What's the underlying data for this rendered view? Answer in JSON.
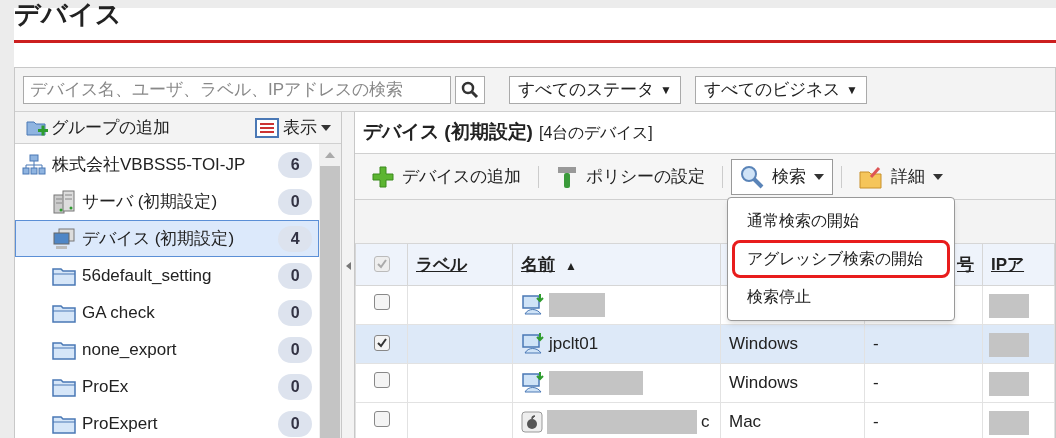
{
  "page_title": "デバイス",
  "filters": {
    "search_placeholder": "デバイス名、ユーザ、ラベル、IPアドレスの検索",
    "dropdowns": [
      {
        "label": "すべてのステータ",
        "caret": "▼"
      },
      {
        "label": "すべてのビジネス",
        "caret": "▼"
      }
    ]
  },
  "sidebar": {
    "add_group": "グループの追加",
    "view": "表示",
    "tree": [
      {
        "kind": "network",
        "label": "株式会社VBBSS5-TOI-JP",
        "count": "6",
        "selected": false,
        "children": [
          {
            "kind": "server",
            "label": "サーバ (初期設定)",
            "count": "0",
            "selected": false
          },
          {
            "kind": "device",
            "label": "デバイス (初期設定)",
            "count": "4",
            "selected": true
          },
          {
            "kind": "folder",
            "label": "56default_setting",
            "count": "0",
            "selected": false
          },
          {
            "kind": "folder",
            "label": "GA check",
            "count": "0",
            "selected": false
          },
          {
            "kind": "folder",
            "label": "none_export",
            "count": "0",
            "selected": false
          },
          {
            "kind": "folder",
            "label": "ProEx",
            "count": "0",
            "selected": false
          },
          {
            "kind": "folder",
            "label": "ProExpert",
            "count": "0",
            "selected": false
          }
        ]
      }
    ]
  },
  "main": {
    "title": "デバイス (初期設定)",
    "subtitle": "[4台のデバイス]",
    "toolbar": [
      {
        "kind": "add",
        "label": "デバイスの追加",
        "open": false,
        "dropdown": false
      },
      {
        "kind": "policy",
        "label": "ポリシーの設定",
        "open": false,
        "dropdown": false
      },
      {
        "kind": "search",
        "label": "検索",
        "open": true,
        "dropdown": true
      },
      {
        "kind": "details",
        "label": "詳細",
        "open": false,
        "dropdown": true
      }
    ],
    "menu": {
      "items": [
        {
          "label": "通常検索の開始",
          "highlighted": false
        },
        {
          "label": "アグレッシブ検索の開始",
          "highlighted": true
        },
        {
          "label": "検索停止",
          "highlighted": false
        }
      ]
    },
    "table": {
      "header_checked": true,
      "columns": [
        {
          "label": "ラベル"
        },
        {
          "label": "名前",
          "sort": "▲"
        },
        {
          "label": "号"
        },
        {
          "label": "IPア"
        }
      ],
      "rows": [
        {
          "checked": false,
          "selected": false,
          "kind": "windows",
          "redacted": true
        },
        {
          "checked": true,
          "selected": true,
          "kind": "windows",
          "name": "jpclt01",
          "os": "Windows",
          "column_5": "-"
        },
        {
          "checked": false,
          "selected": false,
          "kind": "windows",
          "redacted": true,
          "os": "Windows",
          "column_5": "-"
        },
        {
          "checked": false,
          "selected": false,
          "kind": "mac",
          "redacted": true,
          "name": "c",
          "os": "Mac",
          "column_5": "-"
        }
      ]
    }
  }
}
